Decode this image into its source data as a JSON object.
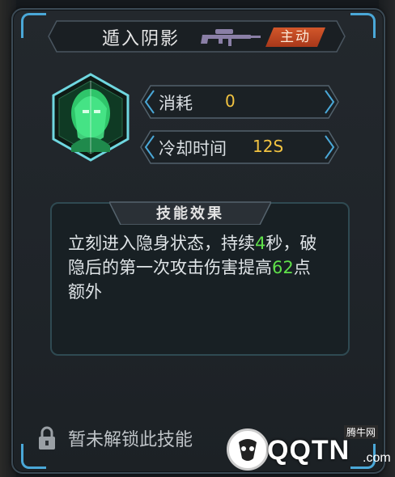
{
  "skill": {
    "name": "遁入阴影",
    "weapon_icon": "sniper-rifle-icon",
    "type_badge": "主动",
    "badge_color": "#c2471f"
  },
  "portrait": {
    "icon": "hooded-assassin-portrait-icon",
    "glow_color": "#39e07a"
  },
  "stats": [
    {
      "label": "消耗",
      "value": "0"
    },
    {
      "label": "冷却时间",
      "value": "12S"
    }
  ],
  "effect": {
    "title": "技能效果",
    "text_parts": [
      {
        "text": "立刻进入隐身状态，持续"
      },
      {
        "text": "4",
        "highlight": true
      },
      {
        "text": "秒，破隐后的第一次攻击伤害提高"
      },
      {
        "text": "62",
        "highlight": true
      },
      {
        "text": "点额外"
      }
    ],
    "highlight_color": "#5fe04a"
  },
  "lock": {
    "icon": "padlock-icon",
    "text": "暂未解锁此技能"
  },
  "watermark": {
    "brand": "QQTN",
    "domain": ".com",
    "tag": "腾牛网"
  },
  "colors": {
    "accent": "#4aa8d8",
    "value_yellow": "#f2c341"
  }
}
